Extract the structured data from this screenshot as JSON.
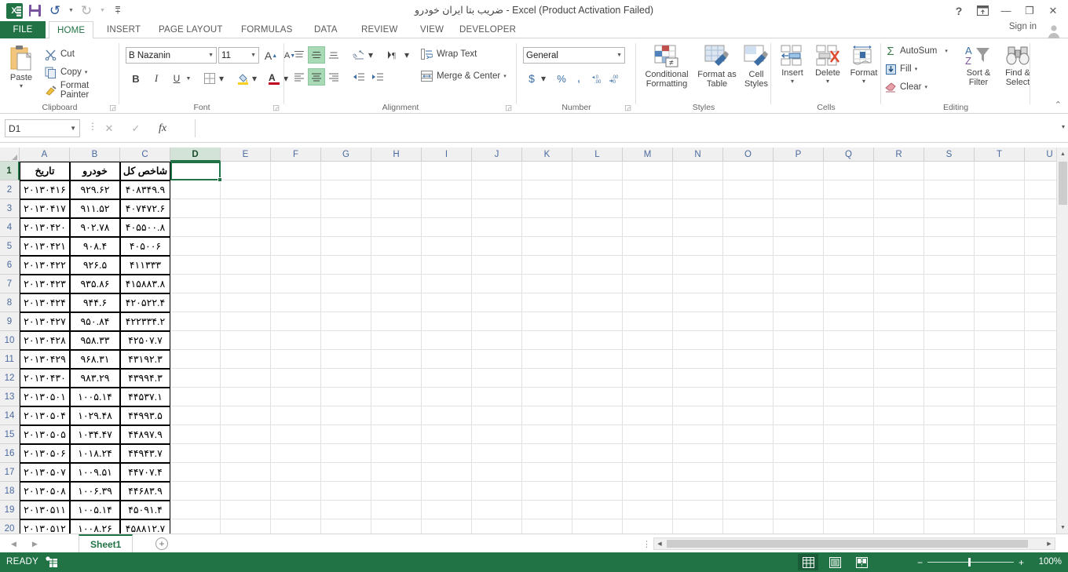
{
  "window": {
    "title": "ضریب بتا ایران خودرو - Excel (Product Activation Failed)",
    "help_icon": "?",
    "ribbon_display_icon": "ribbon-display-options-icon",
    "minimize_icon": "—",
    "restore_icon": "❐",
    "close_icon": "✕",
    "sign_in": "Sign in"
  },
  "qat": {
    "logo": "X",
    "save": "save-icon",
    "undo": "↺",
    "undo_caret": "▾",
    "redo": "↻",
    "redo_caret": "▾",
    "customize": "▾"
  },
  "tabs": [
    {
      "label": "FILE",
      "id": "file"
    },
    {
      "label": "HOME",
      "id": "home"
    },
    {
      "label": "INSERT",
      "id": "insert"
    },
    {
      "label": "PAGE LAYOUT",
      "id": "page-layout"
    },
    {
      "label": "FORMULAS",
      "id": "formulas"
    },
    {
      "label": "DATA",
      "id": "data"
    },
    {
      "label": "REVIEW",
      "id": "review"
    },
    {
      "label": "VIEW",
      "id": "view"
    },
    {
      "label": "DEVELOPER",
      "id": "developer"
    }
  ],
  "ribbon": {
    "clipboard": {
      "label": "Clipboard",
      "paste": "Paste",
      "paste_caret": "▾",
      "cut": "Cut",
      "copy": "Copy",
      "copy_caret": "▾",
      "format_painter": "Format Painter",
      "launcher": "◲"
    },
    "font": {
      "label": "Font",
      "font_name": "B Nazanin",
      "font_size": "11",
      "grow_font": "A",
      "shrink_font": "A",
      "bold": "B",
      "italic": "I",
      "underline": "U",
      "underline_caret": "▾",
      "borders_caret": "▾",
      "fill_caret": "▾",
      "font_color": "A",
      "font_color_caret": "▾",
      "launcher": "◲"
    },
    "alignment": {
      "label": "Alignment",
      "wrap_text": "Wrap Text",
      "merge_center": "Merge & Center",
      "merge_caret": "▾",
      "orientation_caret": "▾",
      "rtl_caret": "▾",
      "launcher": "◲"
    },
    "number": {
      "label": "Number",
      "format": "General",
      "format_caret": "▾",
      "currency": "$",
      "currency_caret": "▾",
      "percent": "%",
      "comma": ",",
      "increase_decimal": ".00",
      "decrease_decimal": ".00",
      "launcher": "◲"
    },
    "styles": {
      "label": "Styles",
      "conditional_formatting": "Conditional\nFormatting",
      "conditional_formatting_l1": "Conditional",
      "conditional_formatting_l2": "Formatting",
      "format_as_table_l1": "Format as",
      "format_as_table_l2": "Table",
      "cell_styles_l1": "Cell",
      "cell_styles_l2": "Styles",
      "caret": "▾"
    },
    "cells": {
      "label": "Cells",
      "insert": "Insert",
      "delete": "Delete",
      "format": "Format",
      "caret": "▾"
    },
    "editing": {
      "label": "Editing",
      "autosum": "AutoSum",
      "autosum_caret": "▾",
      "fill": "Fill",
      "fill_caret": "▾",
      "clear": "Clear",
      "clear_caret": "▾",
      "sort_filter_l1": "Sort &",
      "sort_filter_l2": "Filter",
      "find_select_l1": "Find &",
      "find_select_l2": "Select",
      "caret": "▾"
    },
    "collapse_icon": "⌃"
  },
  "formula_bar": {
    "name_box": "D1",
    "name_box_caret": "▾",
    "cancel_icon": "✕",
    "enter_icon": "✓",
    "fx_icon": "fx",
    "value": "",
    "expand_caret": "▾"
  },
  "grid": {
    "columns": [
      "A",
      "B",
      "C",
      "D",
      "E",
      "F",
      "G",
      "H",
      "I",
      "J",
      "K",
      "L",
      "M",
      "N",
      "O",
      "P",
      "Q",
      "R",
      "S",
      "T",
      "U"
    ],
    "selected_column": "D",
    "selected_row": 1,
    "selected_cell": "D1",
    "row_numbers": [
      1,
      2,
      3,
      4,
      5,
      6,
      7,
      8,
      9,
      10,
      11,
      12,
      13,
      14,
      15,
      16,
      17,
      18,
      19,
      20
    ],
    "headers": {
      "A": "تاریخ",
      "B": "خودرو",
      "C": "شاخص کل"
    },
    "rows": [
      {
        "row": 1,
        "A": "تاریخ",
        "B": "خودرو",
        "C": "شاخص کل"
      },
      {
        "row": 2,
        "A": "۲۰۱۳۰۴۱۶",
        "B": "۹۲۹.۶۲",
        "C": "۴۰۸۳۴۹.۹"
      },
      {
        "row": 3,
        "A": "۲۰۱۳۰۴۱۷",
        "B": "۹۱۱.۵۲",
        "C": "۴۰۷۴۷۲.۶"
      },
      {
        "row": 4,
        "A": "۲۰۱۳۰۴۲۰",
        "B": "۹۰۲.۷۸",
        "C": "۴۰۵۵۰۰.۸"
      },
      {
        "row": 5,
        "A": "۲۰۱۳۰۴۲۱",
        "B": "۹۰۸.۴",
        "C": "۴۰۵۰۰۶"
      },
      {
        "row": 6,
        "A": "۲۰۱۳۰۴۲۲",
        "B": "۹۲۶.۵",
        "C": "۴۱۱۳۳۳"
      },
      {
        "row": 7,
        "A": "۲۰۱۳۰۴۲۳",
        "B": "۹۳۵.۸۶",
        "C": "۴۱۵۸۸۳.۸"
      },
      {
        "row": 8,
        "A": "۲۰۱۳۰۴۲۴",
        "B": "۹۴۴.۶",
        "C": "۴۲۰۵۲۲.۴"
      },
      {
        "row": 9,
        "A": "۲۰۱۳۰۴۲۷",
        "B": "۹۵۰.۸۴",
        "C": "۴۲۲۳۳۴.۲"
      },
      {
        "row": 10,
        "A": "۲۰۱۳۰۴۲۸",
        "B": "۹۵۸.۳۳",
        "C": "۴۲۵۰۷.۷"
      },
      {
        "row": 11,
        "A": "۲۰۱۳۰۴۲۹",
        "B": "۹۶۸.۳۱",
        "C": "۴۳۱۹۲.۳"
      },
      {
        "row": 12,
        "A": "۲۰۱۳۰۴۳۰",
        "B": "۹۸۳.۲۹",
        "C": "۴۳۹۹۴.۳"
      },
      {
        "row": 13,
        "A": "۲۰۱۳۰۵۰۱",
        "B": "۱۰۰۵.۱۴",
        "C": "۴۴۵۳۷.۱"
      },
      {
        "row": 14,
        "A": "۲۰۱۳۰۵۰۴",
        "B": "۱۰۲۹.۴۸",
        "C": "۴۴۹۹۳.۵"
      },
      {
        "row": 15,
        "A": "۲۰۱۳۰۵۰۵",
        "B": "۱۰۳۴.۴۷",
        "C": "۴۴۸۹۷.۹"
      },
      {
        "row": 16,
        "A": "۲۰۱۳۰۵۰۶",
        "B": "۱۰۱۸.۲۴",
        "C": "۴۴۹۴۳.۷"
      },
      {
        "row": 17,
        "A": "۲۰۱۳۰۵۰۷",
        "B": "۱۰۰۹.۵۱",
        "C": "۴۴۷۰۷.۴"
      },
      {
        "row": 18,
        "A": "۲۰۱۳۰۵۰۸",
        "B": "۱۰۰۶.۳۹",
        "C": "۴۴۶۸۳.۹"
      },
      {
        "row": 19,
        "A": "۲۰۱۳۰۵۱۱",
        "B": "۱۰۰۵.۱۴",
        "C": "۴۵۰۹۱.۴"
      },
      {
        "row": 20,
        "A": "۲۰۱۳۰۵۱۲",
        "B": "۱۰۰۸.۲۶",
        "C": "۴۵۸۸۱۲.۷"
      }
    ]
  },
  "sheet_bar": {
    "prev_icon": "◀",
    "next_icon": "▶",
    "sheets": [
      "Sheet1"
    ],
    "active_sheet": "Sheet1",
    "add_sheet": "+",
    "split_icon": "⋮"
  },
  "status_bar": {
    "state": "READY",
    "macro_record_icon": "macro-record-icon",
    "view_normal": "normal-view-icon",
    "view_page_layout": "page-layout-view-icon",
    "view_page_break": "page-break-view-icon",
    "zoom_out": "−",
    "zoom_in": "+",
    "zoom_level": "100%"
  },
  "colors": {
    "accent": "#217346",
    "ribbon_text": "#444444",
    "header_text": "#4a6a9e"
  }
}
